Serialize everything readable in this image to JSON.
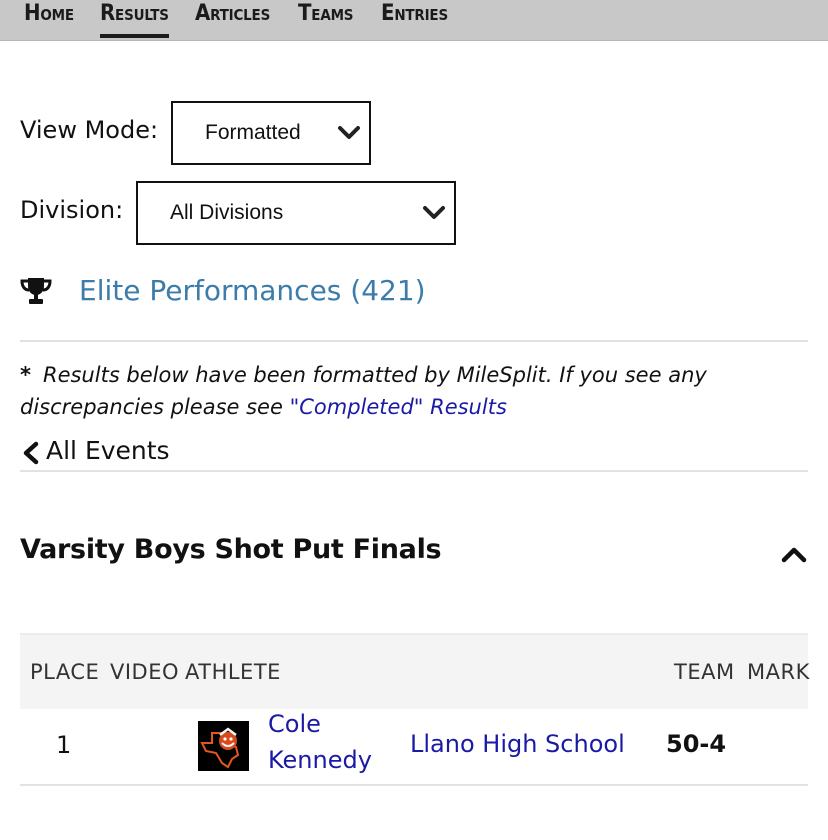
{
  "nav": {
    "items": [
      {
        "label": "Home",
        "active": false
      },
      {
        "label": "Results",
        "active": true
      },
      {
        "label": "Articles",
        "active": false
      },
      {
        "label": "Teams",
        "active": false
      },
      {
        "label": "Entries",
        "active": false
      }
    ]
  },
  "filters": {
    "view_mode_label": "View Mode:",
    "view_mode_value": "Formatted",
    "division_label": "Division:",
    "division_value": "All Divisions"
  },
  "elite": {
    "label": "Elite Performances (421)"
  },
  "note": {
    "star": "*",
    "text": "Results below have been formatted by MileSplit. If you see any discrepancies please see ",
    "link": "\"Completed\" Results"
  },
  "back": {
    "label": "All Events"
  },
  "event": {
    "title": "Varsity Boys Shot Put Finals"
  },
  "table": {
    "headers": {
      "place": "PLACE",
      "video": "VIDEO",
      "athlete": "ATHLETE",
      "team": "TEAM",
      "mark": "MARK"
    },
    "rows": [
      {
        "place": "1",
        "athlete_first": "Cole",
        "athlete_last": "Kennedy",
        "team": "Llano High School",
        "mark": "50-4"
      }
    ]
  },
  "colors": {
    "nav_bg": "#c8c8c8",
    "elite_link": "#3b7cab",
    "link": "#1a1aa6",
    "header_bg": "#f4f4f4"
  },
  "icons": {
    "trophy": "trophy-icon",
    "chevron_down": "chevron-down-icon",
    "chevron_left": "chevron-left-icon",
    "chevron_up": "chevron-up-icon",
    "team_logo": "team-logo"
  }
}
